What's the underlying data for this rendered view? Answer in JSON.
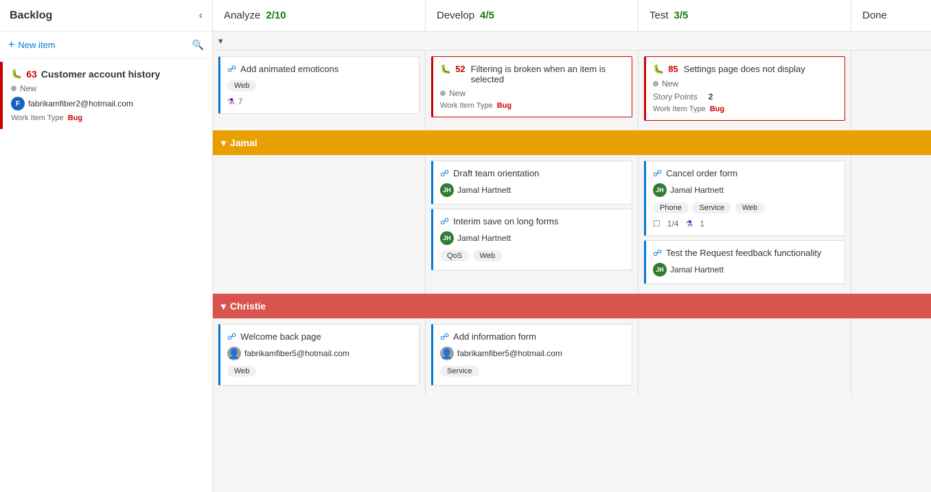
{
  "sidebar": {
    "title": "Backlog",
    "chevron": "‹",
    "new_item_label": "New item",
    "item": {
      "id": "63",
      "title": "Customer account history",
      "status": "New",
      "email": "fabrikamfiber2@hotmail.com",
      "work_item_type_label": "Work Item Type",
      "work_item_type": "Bug"
    }
  },
  "columns": {
    "analyze": {
      "label": "Analyze",
      "count": "2",
      "total": "10"
    },
    "develop": {
      "label": "Develop",
      "count": "4",
      "total": "5"
    },
    "test": {
      "label": "Test",
      "count": "3",
      "total": "5"
    },
    "done": {
      "label": "Done"
    }
  },
  "collapse_bar": {
    "chevron": "▾"
  },
  "unassigned_cards": {
    "analyze": [
      {
        "id": "",
        "title": "Add animated emoticons",
        "type": "story",
        "tags": [
          "Web"
        ],
        "test_count": "7"
      }
    ],
    "develop": [
      {
        "id": "52",
        "title": "Filtering is broken when an item is selected",
        "type": "bug",
        "status": "New",
        "work_item_type_label": "Work Item Type",
        "work_item_type": "Bug"
      }
    ],
    "test": [
      {
        "id": "85",
        "title": "Settings page does not display",
        "type": "bug",
        "status": "New",
        "story_points_label": "Story Points",
        "story_points": "2",
        "work_item_type_label": "Work Item Type",
        "work_item_type": "Bug"
      }
    ]
  },
  "swimlane_jamal": {
    "label": "Jamal",
    "chevron": "▾",
    "develop_cards": [
      {
        "title": "Draft team orientation",
        "type": "story",
        "assignee": "Jamal Hartnett",
        "avatar_initials": "JH"
      },
      {
        "title": "Interim save on long forms",
        "type": "story",
        "assignee": "Jamal Hartnett",
        "avatar_initials": "JH",
        "tags": [
          "QoS",
          "Web"
        ]
      }
    ],
    "test_cards": [
      {
        "title": "Cancel order form",
        "type": "story",
        "assignee": "Jamal Hartnett",
        "avatar_initials": "JH",
        "tags": [
          "Phone",
          "Service",
          "Web"
        ],
        "progress": "1/4",
        "test_count": "1"
      },
      {
        "title": "Test the Request feedback functionality",
        "type": "story",
        "assignee": "Jamal Hartnett",
        "avatar_initials": "JH"
      }
    ]
  },
  "swimlane_christie": {
    "label": "Christie",
    "chevron": "▾",
    "analyze_cards": [
      {
        "title": "Welcome back page",
        "type": "story",
        "assignee": "fabrikamfiber5@hotmail.com",
        "tags": [
          "Web"
        ]
      },
      {
        "title": "Add information form",
        "type": "story",
        "assignee": "fabrikamfiber5@hotmail.com",
        "tags": [
          "Service"
        ]
      }
    ]
  }
}
